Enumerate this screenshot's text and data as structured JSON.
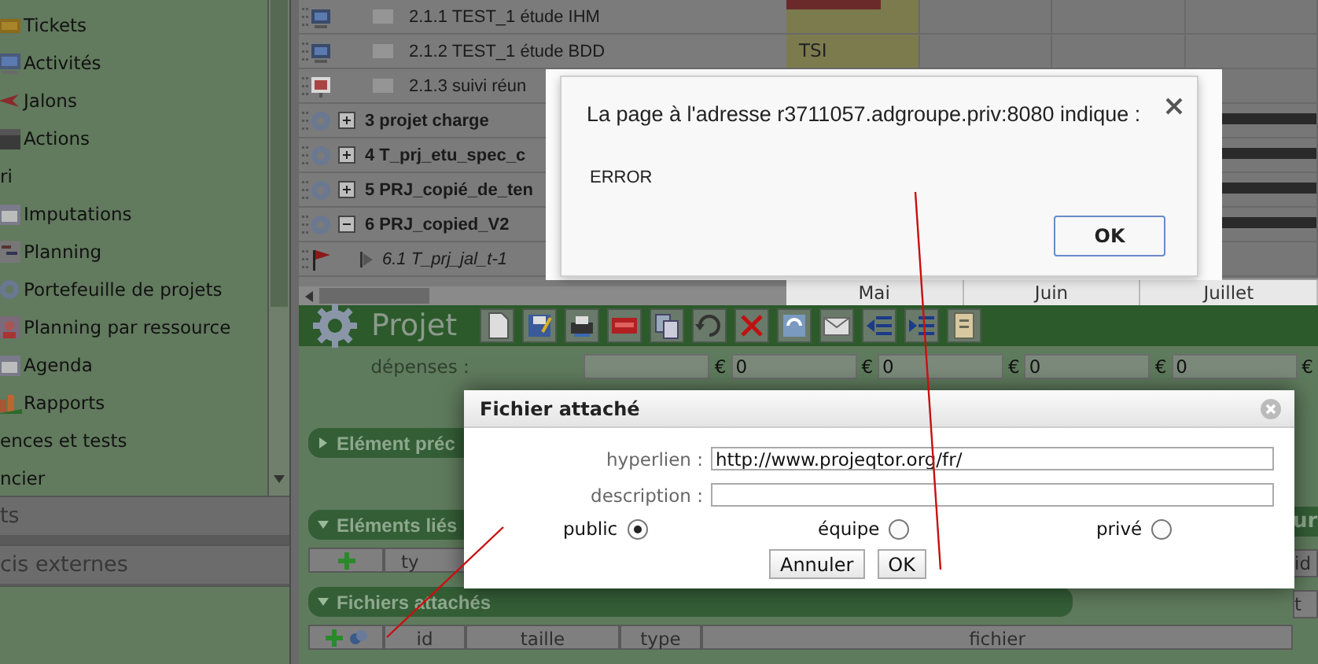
{
  "sidebar": {
    "items": [
      {
        "kind": "item",
        "label": "Tickets"
      },
      {
        "kind": "item",
        "label": "Activités"
      },
      {
        "kind": "item",
        "label": "Jalons"
      },
      {
        "kind": "item",
        "label": "Actions"
      },
      {
        "kind": "group",
        "label": "ri"
      },
      {
        "kind": "item",
        "label": "Imputations"
      },
      {
        "kind": "item",
        "label": "Planning"
      },
      {
        "kind": "item",
        "label": "Portefeuille de projets"
      },
      {
        "kind": "item",
        "label": "Planning par ressource"
      },
      {
        "kind": "item",
        "label": "Agenda"
      },
      {
        "kind": "item",
        "label": "Rapports"
      },
      {
        "kind": "group",
        "label": "ences et tests"
      },
      {
        "kind": "group",
        "label": "ncier"
      }
    ],
    "panes": [
      "ts",
      "cis externes"
    ]
  },
  "gantt": {
    "tasks": [
      {
        "kind": "activity",
        "name": "2.1.1 TEST_1 étude IHM"
      },
      {
        "kind": "activity",
        "name": "2.1.2 TEST_1 étude BDD",
        "resource": "TSI"
      },
      {
        "kind": "meeting",
        "name": "2.1.3 suivi réun"
      },
      {
        "kind": "project",
        "name": "3 projet charge",
        "expanded": false
      },
      {
        "kind": "project",
        "name": "4 T_prj_etu_spec_c",
        "expanded": false
      },
      {
        "kind": "project",
        "name": "5 PRJ_copié_de_ten",
        "expanded": false
      },
      {
        "kind": "project",
        "name": "6 PRJ_copied_V2",
        "expanded": true,
        "children": [
          {
            "kind": "milestone",
            "name": "6.1 T_prj_jal_t-1"
          }
        ]
      }
    ],
    "months": [
      "Mai",
      "Juin",
      "Juillet"
    ]
  },
  "project": {
    "title": "Projet",
    "toolbar": [
      {
        "kind": "new"
      },
      {
        "kind": "save"
      },
      {
        "kind": "print"
      },
      {
        "kind": "pdf"
      },
      {
        "kind": "copy"
      },
      {
        "kind": "undo"
      },
      {
        "kind": "delete"
      },
      {
        "kind": "refresh"
      },
      {
        "kind": "mail"
      },
      {
        "kind": "outdent"
      },
      {
        "kind": "indent"
      },
      {
        "kind": "checklist"
      }
    ],
    "expenses": {
      "label": "dépenses :",
      "currency": "€",
      "fields": [
        {
          "kind": "blank"
        },
        {
          "kind": "amount",
          "value": "0"
        },
        {
          "kind": "amount",
          "value": "0"
        },
        {
          "kind": "amount",
          "value": "0"
        },
        {
          "kind": "amount",
          "value": "0"
        }
      ]
    },
    "sections": [
      {
        "title": "Elément préc",
        "expanded": false
      },
      {
        "title": "Eléments liés",
        "expanded": true,
        "columns": [
          "ty"
        ]
      },
      {
        "title": "Fichiers attachés",
        "expanded": true,
        "columns": [
          "id",
          "taille",
          "type",
          "fichier"
        ]
      }
    ],
    "right_fragments": {
      "section": "ur",
      "cells": [
        "id",
        "t"
      ]
    }
  },
  "alert": {
    "message": "La page à l'adresse r3711057.adgroupe.priv:8080 indique :",
    "body": "ERROR",
    "button": "OK"
  },
  "dialog": {
    "title": "Fichier attaché",
    "fields": [
      {
        "label": "hyperlien :",
        "value": "http://www.projeqtor.org/fr/"
      },
      {
        "label": "description :"
      }
    ],
    "visibility": [
      {
        "label": "public",
        "selected": true
      },
      {
        "label": "équipe",
        "selected": false
      },
      {
        "label": "privé",
        "selected": false
      }
    ],
    "buttons": [
      "Annuler",
      "OK"
    ]
  }
}
